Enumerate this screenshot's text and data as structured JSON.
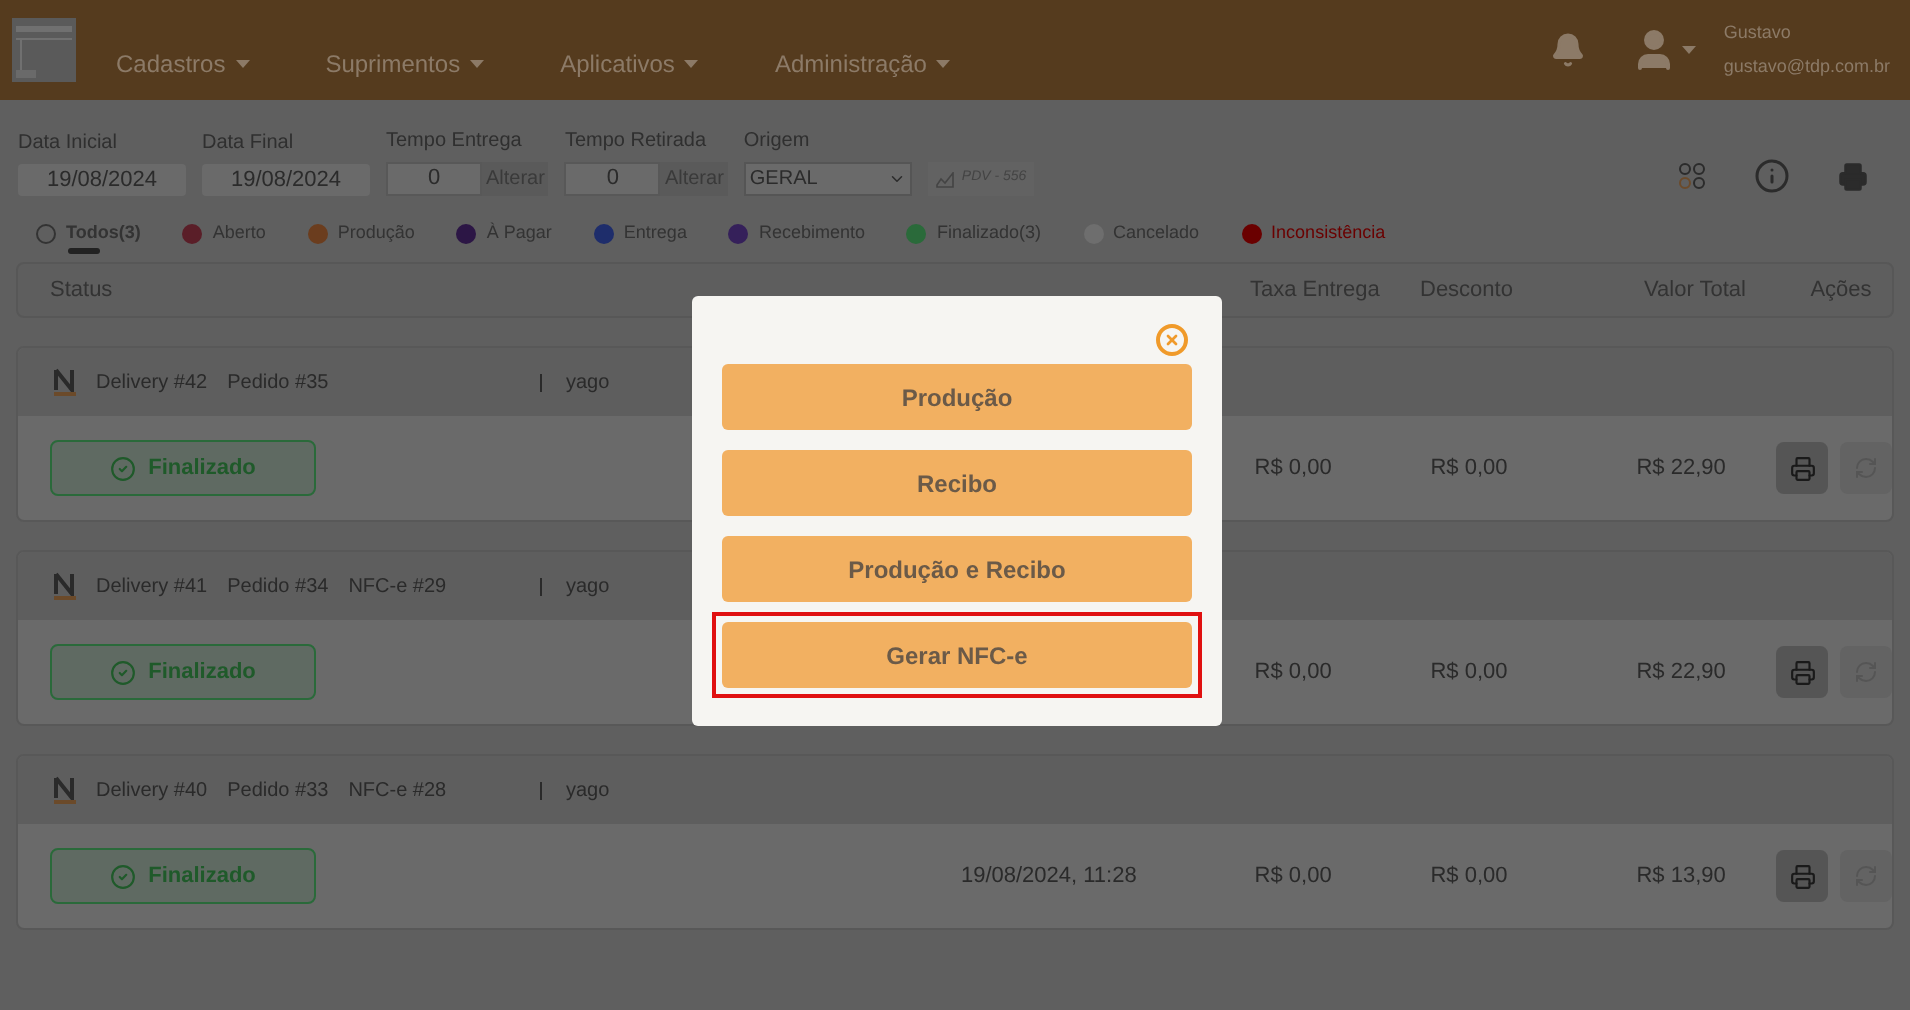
{
  "nav": {
    "menus": [
      "Cadastros",
      "Suprimentos",
      "Aplicativos",
      "Administração"
    ],
    "user": {
      "name": "Gustavo",
      "email": "gustavo@tdp.com.br"
    }
  },
  "filters": {
    "fields": [
      {
        "kind": "date",
        "label": "Data Inicial",
        "value": "19/08/2024"
      },
      {
        "kind": "date",
        "label": "Data Final",
        "value": "19/08/2024"
      },
      {
        "kind": "time",
        "label": "Tempo Entrega",
        "value": "0",
        "action": "Alterar"
      },
      {
        "kind": "time",
        "label": "Tempo Retirada",
        "value": "0",
        "action": "Alterar"
      },
      {
        "kind": "select",
        "label": "Origem",
        "value": "GERAL"
      }
    ],
    "pdv": "PDV - 556"
  },
  "legend": [
    {
      "label": "Todos(3)",
      "selected": true
    },
    {
      "label": "Aberto",
      "selected": false,
      "color": "#5a1e28"
    },
    {
      "label": "Produção",
      "selected": false,
      "color": "#6b3d1e"
    },
    {
      "label": "À Pagar",
      "selected": false,
      "color": "#2c1645"
    },
    {
      "label": "Entrega",
      "selected": false,
      "color": "#1e2d6b"
    },
    {
      "label": "Recebimento",
      "selected": false,
      "color": "#35205a"
    },
    {
      "label": "Finalizado(3)",
      "selected": false,
      "color": "#2a6a3a"
    },
    {
      "label": "Cancelado",
      "selected": false,
      "color": "#6e6e6e"
    },
    {
      "label": "Inconsistência",
      "selected": false,
      "color": "#6a0000",
      "alert": true
    }
  ],
  "table": {
    "columns": [
      "Status",
      "Taxa Entrega",
      "Desconto",
      "Valor Total",
      "Ações"
    ],
    "rows": [
      {
        "title": [
          "Delivery #42",
          "Pedido #35"
        ],
        "user": "yago",
        "status": "Finalizado",
        "fee": "R$ 0,00",
        "discount": "R$ 0,00",
        "total": "R$ 22,90"
      },
      {
        "title": [
          "Delivery #41",
          "Pedido #34",
          "NFC-e #29"
        ],
        "user": "yago",
        "status": "Finalizado",
        "fee": "R$ 0,00",
        "discount": "R$ 0,00",
        "total": "R$ 22,90"
      },
      {
        "title": [
          "Delivery #40",
          "Pedido #33",
          "NFC-e #28"
        ],
        "user": "yago",
        "status": "Finalizado",
        "datetime": "19/08/2024, 11:28",
        "fee": "R$ 0,00",
        "discount": "R$ 0,00",
        "total": "R$ 13,90"
      }
    ]
  },
  "modal": {
    "options": [
      {
        "label": "Produção",
        "highlighted": false
      },
      {
        "label": "Recibo",
        "highlighted": false
      },
      {
        "label": "Produção e Recibo",
        "highlighted": false
      },
      {
        "label": "Gerar NFC-e",
        "highlighted": true
      }
    ]
  }
}
